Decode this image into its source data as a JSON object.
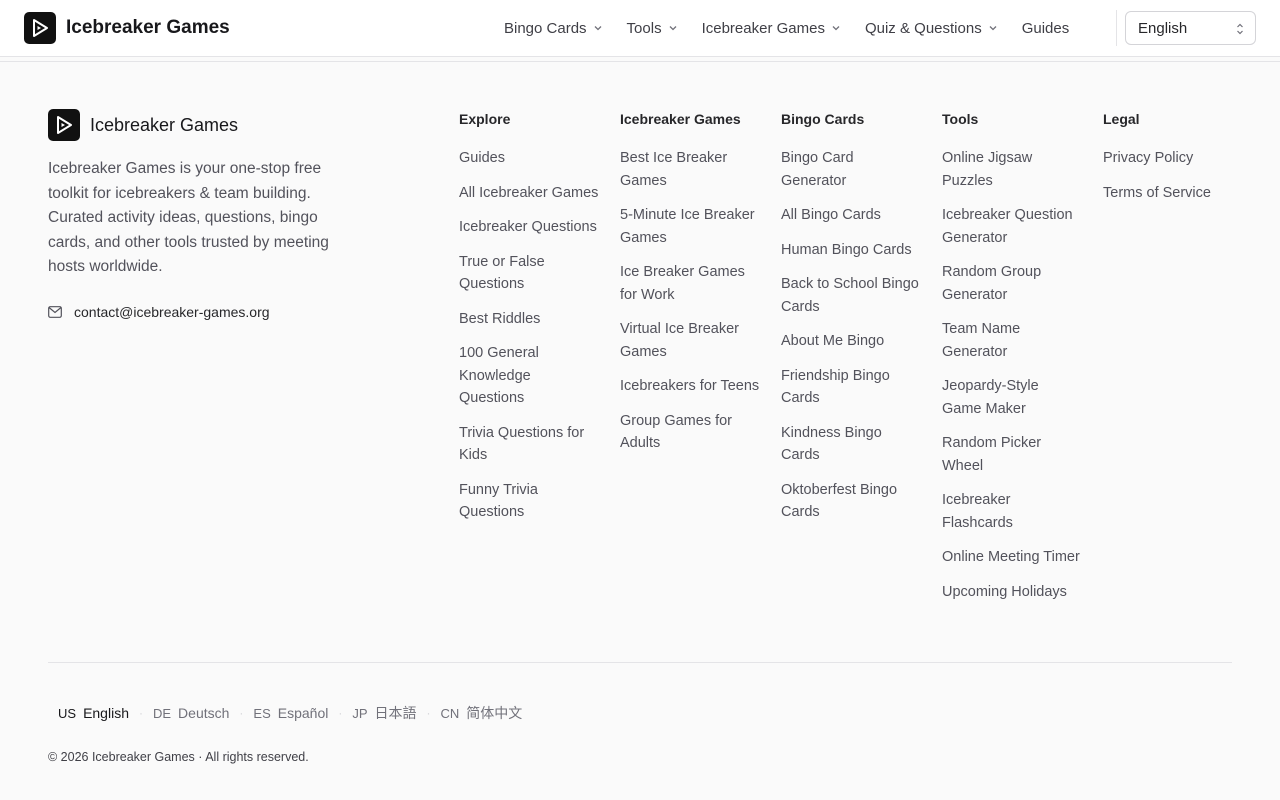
{
  "header": {
    "brand": "Icebreaker Games",
    "nav": [
      {
        "label": "Bingo Cards",
        "dropdown": true
      },
      {
        "label": "Tools",
        "dropdown": true
      },
      {
        "label": "Icebreaker Games",
        "dropdown": true
      },
      {
        "label": "Quiz & Questions",
        "dropdown": true
      },
      {
        "label": "Guides",
        "dropdown": false
      }
    ],
    "language_selected": "English"
  },
  "footer": {
    "brand": "Icebreaker Games",
    "description": "Icebreaker Games is your one-stop free toolkit for icebreakers & team building. Curated activity ideas, questions, bingo cards, and other tools trusted by meeting hosts worldwide.",
    "email": "contact@icebreaker-games.org",
    "columns": [
      {
        "title": "Explore",
        "links": [
          "Guides",
          "All Icebreaker Games",
          "Icebreaker Questions",
          "True or False Questions",
          "Best Riddles",
          "100 General Knowledge Questions",
          "Trivia Questions for Kids",
          "Funny Trivia Questions"
        ]
      },
      {
        "title": "Icebreaker Games",
        "links": [
          "Best Ice Breaker Games",
          "5-Minute Ice Breaker Games",
          "Ice Breaker Games for Work",
          "Virtual Ice Breaker Games",
          "Icebreakers for Teens",
          "Group Games for Adults"
        ]
      },
      {
        "title": "Bingo Cards",
        "links": [
          "Bingo Card Generator",
          "All Bingo Cards",
          "Human Bingo Cards",
          "Back to School Bingo Cards",
          "About Me Bingo",
          "Friendship Bingo Cards",
          "Kindness Bingo Cards",
          "Oktoberfest Bingo Cards"
        ]
      },
      {
        "title": "Tools",
        "links": [
          "Online Jigsaw Puzzles",
          "Icebreaker Question Generator",
          "Random Group Generator",
          "Team Name Generator",
          "Jeopardy-Style Game Maker",
          "Random Picker Wheel",
          "Icebreaker Flashcards",
          "Online Meeting Timer",
          "Upcoming Holidays"
        ]
      },
      {
        "title": "Legal",
        "links": [
          "Privacy Policy",
          "Terms of Service"
        ]
      }
    ],
    "languages": [
      {
        "code": "US",
        "label": "English",
        "active": true
      },
      {
        "code": "DE",
        "label": "Deutsch",
        "active": false
      },
      {
        "code": "ES",
        "label": "Español",
        "active": false
      },
      {
        "code": "JP",
        "label": "日本語",
        "active": false
      },
      {
        "code": "CN",
        "label": "简体中文",
        "active": false
      }
    ],
    "separator": "·",
    "copyright": "© 2026 Icebreaker Games · All rights reserved."
  }
}
